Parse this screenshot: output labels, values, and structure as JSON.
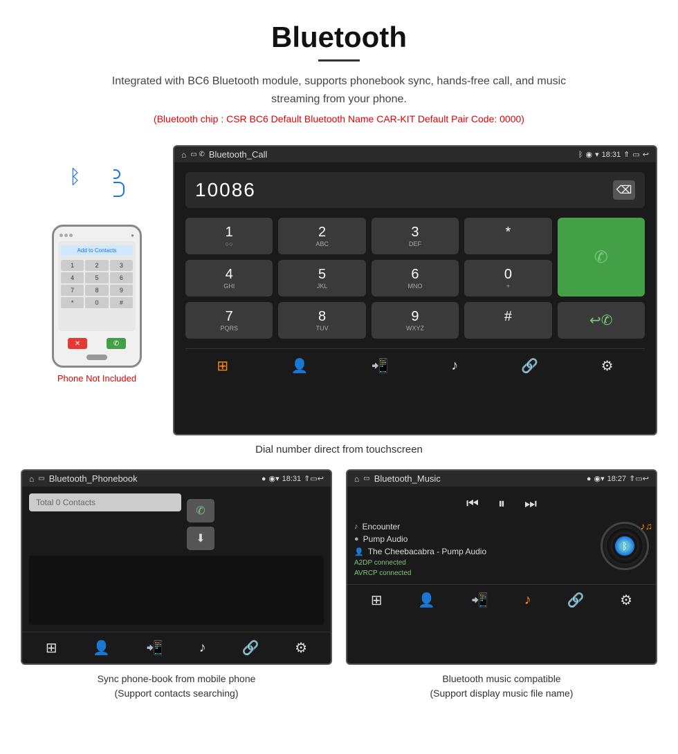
{
  "header": {
    "title": "Bluetooth",
    "description": "Integrated with BC6 Bluetooth module, supports phonebook sync, hands-free call, and music streaming from your phone.",
    "specs": "(Bluetooth chip : CSR BC6    Default Bluetooth Name CAR-KIT    Default Pair Code: 0000)"
  },
  "phone": {
    "not_included": "Phone Not Included",
    "add_contact": "Add to Contacts"
  },
  "dialer": {
    "status_title": "Bluetooth_Call",
    "time": "18:31",
    "number": "10086",
    "keys": [
      {
        "main": "1",
        "sub": "◌◌"
      },
      {
        "main": "2",
        "sub": "ABC"
      },
      {
        "main": "3",
        "sub": "DEF"
      },
      {
        "main": "*",
        "sub": ""
      },
      {
        "main": "📞",
        "sub": "",
        "type": "call"
      },
      {
        "main": "4",
        "sub": "GHI"
      },
      {
        "main": "5",
        "sub": "JKL"
      },
      {
        "main": "6",
        "sub": "MNO"
      },
      {
        "main": "0",
        "sub": "+"
      },
      {
        "main": "📞",
        "sub": "",
        "type": "call2"
      },
      {
        "main": "7",
        "sub": "PQRS"
      },
      {
        "main": "8",
        "sub": "TUV"
      },
      {
        "main": "9",
        "sub": "WXYZ"
      },
      {
        "main": "#",
        "sub": ""
      }
    ],
    "caption": "Dial number direct from touchscreen"
  },
  "phonebook": {
    "status_title": "Bluetooth_Phonebook",
    "time": "18:31",
    "search_placeholder": "Total 0 Contacts",
    "caption_line1": "Sync phone-book from mobile phone",
    "caption_line2": "(Support contacts searching)"
  },
  "music": {
    "status_title": "Bluetooth_Music",
    "time": "18:27",
    "track": "Encounter",
    "artist": "Pump Audio",
    "full_title": "The Cheebacabra - Pump Audio",
    "status1": "A2DP connected",
    "status2": "AVRCP connected",
    "caption_line1": "Bluetooth music compatible",
    "caption_line2": "(Support display music file name)"
  },
  "icons": {
    "bluetooth": "ᛒ",
    "backspace": "⌫",
    "keypad": "⊞",
    "person": "👤",
    "phone_transfer": "📲",
    "music_note": "♪",
    "link": "🔗",
    "settings": "⚙",
    "download": "⬇",
    "rewind": "⏮",
    "play": "⏸",
    "forward": "⏭"
  }
}
